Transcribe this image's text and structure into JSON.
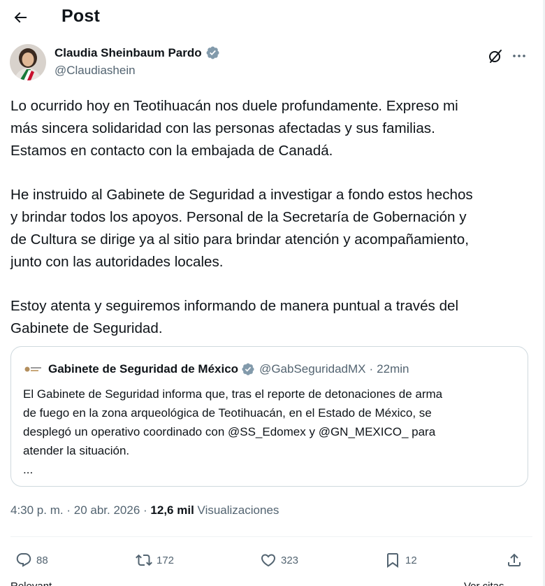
{
  "header": {
    "title": "Post"
  },
  "author": {
    "name": "Claudia Sheinbaum Pardo",
    "handle": "@Claudiashein",
    "avatar_colors": {
      "bg": "#cfcfcf",
      "sash_green": "#1a7a3a",
      "sash_red": "#c8102e",
      "hair": "#3a2a20"
    }
  },
  "tweet": {
    "paragraphs": [
      [
        "Lo ocurrido hoy en Teotihuacán nos duele profundamente. Expreso mi",
        "más sincera solidaridad con las personas afectadas y sus familias.",
        "Estamos en contacto con la embajada de Canadá."
      ],
      [
        "He instruido al Gabinete de Seguridad a investigar a fondo estos hechos",
        "y brindar todos los apoyos. Personal de la Secretaría de Gobernación y",
        "de Cultura se dirige ya al sitio para brindar atención y acompañamiento,",
        "junto con las autoridades locales."
      ],
      [
        "Estoy atenta y seguiremos informando de manera puntual a través del",
        "Gabinete de Seguridad."
      ]
    ]
  },
  "quote": {
    "name": "Gabinete de Seguridad de México",
    "handle": "@GabSeguridadMX",
    "separator": "·",
    "time": "22min",
    "lines": [
      "El Gabinete de Seguridad informa que, tras el reporte de detonaciones de arma",
      "de fuego en la zona arqueológica de Teotihuacán, en el Estado de México, se",
      "desplegó un operativo coordinado con @SS_Edomex y @GN_MEXICO_ para",
      "atender la situación.",
      "..."
    ]
  },
  "meta": {
    "time": "4:30 p. m.",
    "sep": "·",
    "date": "20 abr. 2026",
    "views_count": "12,6 mil",
    "views_label": "Visualizaciones"
  },
  "actions": {
    "replies": "88",
    "reposts": "172",
    "likes": "323",
    "bookmarks": "12"
  },
  "icons": {
    "back": "arrow-left-icon",
    "verified": "verified-badge-icon",
    "grok": "grok-icon",
    "more": "more-dots-icon",
    "reply": "reply-icon",
    "repost": "repost-icon",
    "like": "heart-icon",
    "bookmark": "bookmark-icon",
    "share": "share-icon"
  },
  "colors": {
    "text": "#0f1419",
    "secondary": "#536471",
    "border": "#cfd9de",
    "verified_badge": "#829aab"
  },
  "cutoff": {
    "left": "Relevant",
    "right": "Ver citas"
  }
}
